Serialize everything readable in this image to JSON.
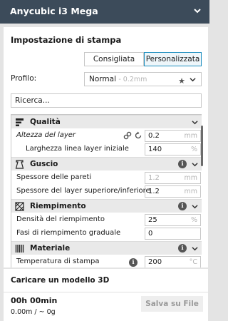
{
  "header": {
    "printer_name": "Anycubic i3 Mega"
  },
  "print_setup": {
    "title": "Impostazione di stampa",
    "modes": [
      "Consigliata",
      "Personalizzata"
    ],
    "active_mode": "Personalizzata",
    "profile_label": "Profilo:",
    "profile_value": "Normal",
    "profile_sub": "- 0.2mm",
    "search_value": "Ricerca...",
    "categories": {
      "quality": "Qualità",
      "shell": "Guscio",
      "infill": "Riempimento",
      "material": "Materiale"
    },
    "settings": {
      "layer_height": {
        "label": "Altezza del layer",
        "value": "0.2",
        "unit": "mm"
      },
      "line_width": {
        "label": "Larghezza linea layer iniziale",
        "value": "140",
        "unit": "%"
      },
      "wall_thickness": {
        "label": "Spessore delle pareti",
        "value": "1.2",
        "unit": "mm"
      },
      "top_bottom": {
        "label": "Spessore del layer superiore/inferiore",
        "value": "1.2",
        "unit": "mm"
      },
      "infill_density": {
        "label": "Densità del riempimento",
        "value": "25",
        "unit": "%"
      },
      "gradual_infill": {
        "label": "Fasi di riempimento graduale",
        "value": "0",
        "unit": ""
      },
      "print_temp": {
        "label": "Temperatura di stampa",
        "value": "200",
        "unit": "°C"
      }
    }
  },
  "footer": {
    "heading": "Caricare un modello 3D",
    "time": "00h 00min",
    "usage": "0.00m / ~ 0g",
    "save_label": "Salva su File"
  },
  "colors": {
    "header_bg": "#3c4b5a",
    "accent": "#1f8fbf"
  },
  "icons": [
    "chevron-down-icon",
    "star-icon",
    "quality-icon",
    "shell-icon",
    "infill-icon",
    "material-icon",
    "info-icon",
    "link-icon",
    "reset-icon"
  ]
}
